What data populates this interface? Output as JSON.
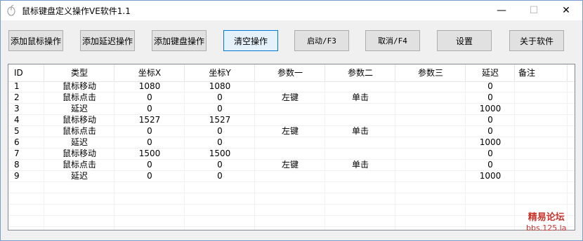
{
  "window": {
    "title": "鼠标键盘定义操作VE软件1.1",
    "minimize_glyph": "—",
    "maximize_glyph": "☐",
    "close_glyph": "✕"
  },
  "toolbar": {
    "add_mouse_label": "添加鼠标操作",
    "add_delay_label": "添加延迟操作",
    "add_keyboard_label": "添加键盘操作",
    "clear_label": "清空操作",
    "start_label": "启动/F3",
    "cancel_label": "取消/F4",
    "settings_label": "设置",
    "about_label": "关于软件"
  },
  "list": {
    "columns": [
      "ID",
      "类型",
      "坐标X",
      "坐标Y",
      "参数一",
      "参数二",
      "参数三",
      "延迟",
      "备注"
    ],
    "rows": [
      [
        "1",
        "鼠标移动",
        "1080",
        "1080",
        "",
        "",
        "",
        "0",
        ""
      ],
      [
        "2",
        "鼠标点击",
        "0",
        "0",
        "左键",
        "单击",
        "",
        "0",
        ""
      ],
      [
        "3",
        "延迟",
        "0",
        "0",
        "",
        "",
        "",
        "1000",
        ""
      ],
      [
        "4",
        "鼠标移动",
        "1527",
        "1527",
        "",
        "",
        "",
        "0",
        ""
      ],
      [
        "5",
        "鼠标点击",
        "0",
        "0",
        "左键",
        "单击",
        "",
        "0",
        ""
      ],
      [
        "6",
        "延迟",
        "0",
        "0",
        "",
        "",
        "",
        "1000",
        ""
      ],
      [
        "7",
        "鼠标移动",
        "1500",
        "1500",
        "",
        "",
        "",
        "0",
        ""
      ],
      [
        "8",
        "鼠标点击",
        "0",
        "0",
        "左键",
        "单击",
        "",
        "0",
        ""
      ],
      [
        "9",
        "延迟",
        "0",
        "0",
        "",
        "",
        "",
        "1000",
        ""
      ]
    ]
  },
  "watermark": {
    "title": "精易论坛",
    "url": "bbs.125.la"
  }
}
